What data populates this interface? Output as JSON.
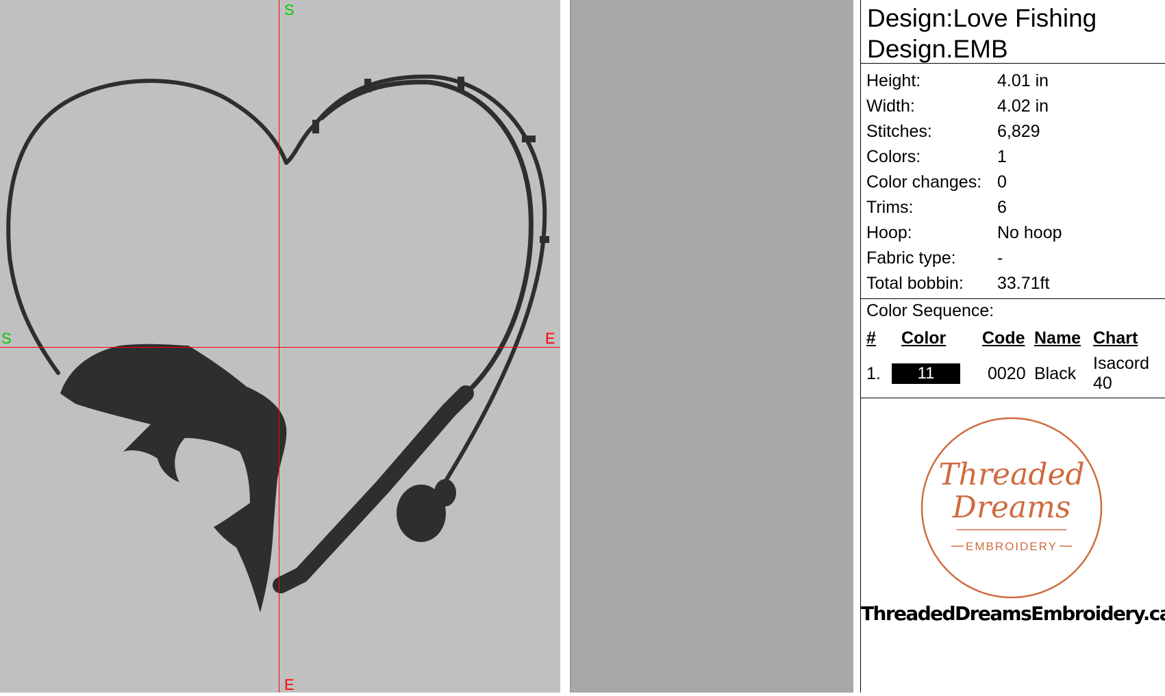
{
  "design": {
    "title_line1": "Design:Love Fishing",
    "title_line2": "Design.EMB"
  },
  "stats": [
    {
      "label": "Height:",
      "value": "4.01 in"
    },
    {
      "label": "Width:",
      "value": "4.02 in"
    },
    {
      "label": "Stitches:",
      "value": "6,829"
    },
    {
      "label": "Colors:",
      "value": "1"
    },
    {
      "label": "Color changes:",
      "value": "0"
    },
    {
      "label": "Trims:",
      "value": "6"
    },
    {
      "label": "Hoop:",
      "value": "No hoop"
    },
    {
      "label": "Fabric type:",
      "value": "-"
    },
    {
      "label": "Total bobbin:",
      "value": "33.71ft"
    }
  ],
  "sequence": {
    "title": "Color Sequence:",
    "headers": {
      "num": "#",
      "color": "Color",
      "code": "Code",
      "name": "Name",
      "chart": "Chart"
    },
    "rows": [
      {
        "num": "1.",
        "swatch": "11",
        "swatch_color": "#000000",
        "code": "0020",
        "name": "Black",
        "chart": "Isacord 40"
      }
    ]
  },
  "axis_labels": {
    "top": "S",
    "left": "S",
    "right": "E",
    "bottom": "E"
  },
  "colors": {
    "canvas": "#c0c0c0",
    "stitch": "#2e2e2e",
    "axis": "#ff0000",
    "axis_label_green": "#00cc00",
    "axis_label_red": "#ff0000",
    "logo": "#cf6b3f"
  },
  "logo": {
    "line1": "Threaded",
    "line2": "Dreams",
    "line3": "EMBROIDERY"
  },
  "website": "ThreadedDreamsEmbroidery.ca"
}
